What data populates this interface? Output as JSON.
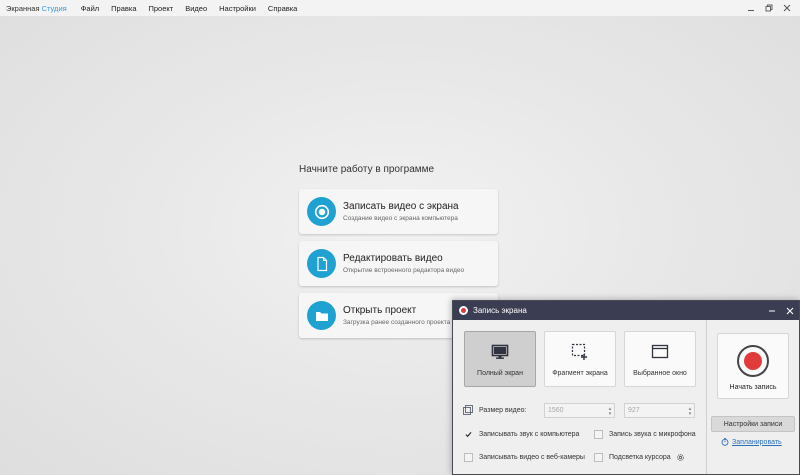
{
  "app": {
    "brand_main": "Экранная ",
    "brand_accent": "Студия",
    "colors": {
      "accent": "#1fa1d2",
      "brand_accent": "#3a9ad9",
      "dialog_title_bg": "#3b3d52",
      "record_red": "#e03c3c"
    }
  },
  "menu": {
    "items": [
      "Файл",
      "Правка",
      "Проект",
      "Видео",
      "Настройки",
      "Справка"
    ]
  },
  "window_controls": {
    "icons": [
      "minimize-icon",
      "restore-icon",
      "close-icon"
    ]
  },
  "start": {
    "heading": "Начните работу в программе",
    "cards": [
      {
        "icon": "record-icon",
        "title": "Записать видео с экрана",
        "subtitle": "Создание видео с экрана компьютера"
      },
      {
        "icon": "document-icon",
        "title": "Редактировать видео",
        "subtitle": "Открытие встроенного редактора видео"
      },
      {
        "icon": "folder-icon",
        "title": "Открыть проект",
        "subtitle": "Загрузка ранее созданного проекта"
      }
    ]
  },
  "dialog": {
    "title": "Запись экрана",
    "modes": [
      {
        "icon": "monitor-icon",
        "label": "Полный экран",
        "active": true
      },
      {
        "icon": "fragment-select-icon",
        "label": "Фрагмент экрана",
        "active": false
      },
      {
        "icon": "window-icon",
        "label": "Выбранное окно",
        "active": false
      }
    ],
    "video_size_label": "Размер видео:",
    "width_value": "1560",
    "height_value": "927",
    "options": [
      {
        "label": "Записывать звук с компьютера",
        "checked": true
      },
      {
        "label": "Запись звука с микрофона",
        "checked": false
      },
      {
        "label": "Записывать видео с веб-камеры",
        "checked": false
      },
      {
        "label": "Подсветка курсора",
        "checked": false
      }
    ],
    "start_recording_label": "Начать запись",
    "record_settings_label": "Настройки записи",
    "schedule_label": "Запланировать"
  }
}
